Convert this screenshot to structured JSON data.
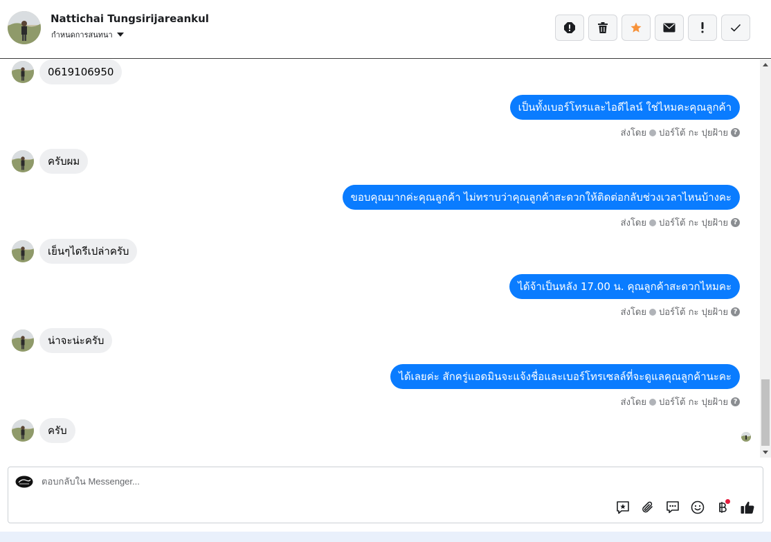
{
  "header": {
    "contact_name": "Nattichai Tungsirijareankul",
    "subtitle": "กำหนดการสนทนา",
    "actions": [
      "report-icon",
      "trash-icon",
      "star-icon",
      "envelope-icon",
      "exclamation-icon",
      "check-icon"
    ]
  },
  "colors": {
    "outgoing_bubble": "#0a7cff",
    "incoming_bubble": "#eeeff1",
    "star": "#f7923a"
  },
  "messages": [
    {
      "dir": "in",
      "text": "0619106950"
    },
    {
      "dir": "out",
      "text": "เป็นทั้งเบอร์โทรและไอดีไลน์ ใช่ไหมคะคุณลูกค้า",
      "sent_by": "ส่งโดย",
      "sender": "ปอร์โต้ กะ ปุยฝ้าย"
    },
    {
      "dir": "in",
      "text": "ครับผม"
    },
    {
      "dir": "out",
      "text": "ขอบคุณมากค่ะคุณลูกค้า ไม่ทราบว่าคุณลูกค้าสะดวกให้ติดต่อกลับช่วงเวลาไหนบ้างคะ",
      "sent_by": "ส่งโดย",
      "sender": "ปอร์โต้ กะ ปุยฝ้าย"
    },
    {
      "dir": "in",
      "text": "เย็นๆไดรีเปล่าครับ"
    },
    {
      "dir": "out",
      "text": "ได้จ้าเป็นหลัง  17.00 น. คุณลูกค้าสะดวกไหมคะ",
      "sent_by": "ส่งโดย",
      "sender": "ปอร์โต้ กะ ปุยฝ้าย"
    },
    {
      "dir": "in",
      "text": "น่าจะน่ะครับ"
    },
    {
      "dir": "out",
      "text": "ได้เลยค่ะ สักครู่แอดมินจะแจ้งชื่อและเบอร์โทรเซลล์ที่จะดูแลคุณลูกค้านะคะ",
      "sent_by": "ส่งโดย",
      "sender": "ปอร์โต้ กะ ปุยฝ้าย"
    },
    {
      "dir": "in",
      "text": "ครับ"
    }
  ],
  "composer": {
    "placeholder": "ตอบกลับใน Messenger...",
    "tools": [
      "saved-reply-icon",
      "attachment-icon",
      "chat-bubble-icon",
      "emoji-icon",
      "baht-payment-icon",
      "thumbs-up-icon"
    ]
  }
}
